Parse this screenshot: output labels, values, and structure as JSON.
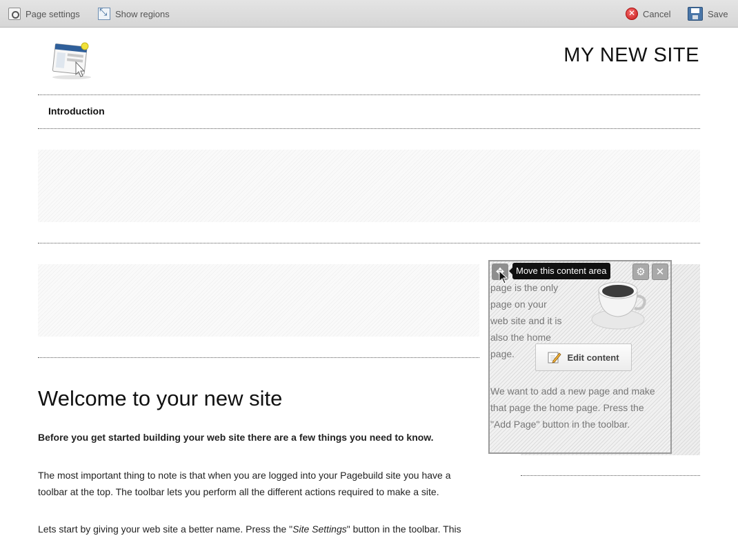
{
  "toolbar": {
    "page_settings": "Page settings",
    "show_regions": "Show regions",
    "cancel": "Cancel",
    "save": "Save"
  },
  "header": {
    "site_title": "MY NEW SITE"
  },
  "nav": {
    "items": [
      {
        "label": "Introduction"
      }
    ]
  },
  "main": {
    "title": "Welcome to your new site",
    "intro": "Before you get started building your web site there are a few things you need to know.",
    "para1_line1": "The most important thing to note is that when you are logged into your Pagebuild site you have a",
    "para1_line2": "toolbar at the top. The toolbar lets you perform all the different actions required to make a site.",
    "para2_before": "Lets start by giving your web site a better name. Press the \"",
    "para2_em": "Site Settings",
    "para2_after": "\" button in the toolbar. This"
  },
  "sidebar_content": {
    "line1": "page is the only",
    "line2": "page on your",
    "line3": "web site and it is",
    "line4": "also the home",
    "line5": "page.",
    "para2_line1": "We want to add a new page and make",
    "para2_line2": "that page the home page. Press the",
    "para2_line3": "\"Add Page\" button in the toolbar.",
    "edit_button": "Edit content",
    "tooltip": "Move this content area"
  },
  "icons": {
    "page_settings": "page-settings-icon",
    "show_regions": "expand-icon",
    "cancel": "cancel-icon",
    "save": "floppy-disk-icon",
    "move": "move-arrows-icon",
    "gear": "gear-icon",
    "close": "close-icon",
    "edit": "pencil-icon"
  },
  "colors": {
    "toolbar_bg": "#dcdcdc",
    "tooltip_bg": "#111111",
    "cancel_red": "#d42a2a",
    "save_blue": "#4a76a8"
  }
}
